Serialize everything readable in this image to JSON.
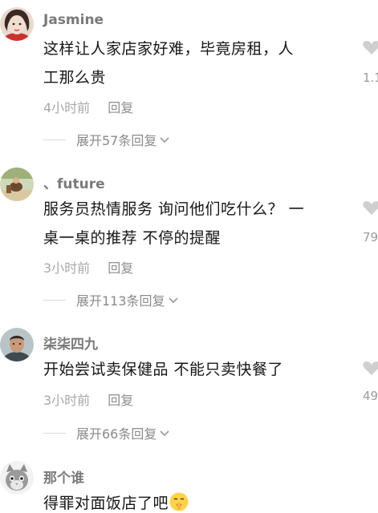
{
  "comments": [
    {
      "username": "Jasmine",
      "body_lines": [
        "这样让人家店家好难，毕竟房租，人",
        "工那么贵"
      ],
      "time": "4小时前",
      "reply_label": "回复",
      "expand_label": "展开57条回复",
      "like_count": "1.1"
    },
    {
      "username": "、future",
      "body_lines": [
        "服务员热情服务 询问他们吃什么？ 一",
        "桌一桌的推荐 不停的提醒"
      ],
      "time": "3小时前",
      "reply_label": "回复",
      "expand_label": "展开113条回复",
      "like_count": "79"
    },
    {
      "username": "柒柒四九",
      "body_lines": [
        "开始尝试卖保健品 不能只卖快餐了"
      ],
      "time": "3小时前",
      "reply_label": "回复",
      "expand_label": "展开66条回复",
      "like_count": "49"
    },
    {
      "username": "那个谁",
      "body_lines": [
        "得罪对面饭店了吧"
      ],
      "time": "",
      "reply_label": "",
      "expand_label": "",
      "like_count": ""
    }
  ],
  "icons": {
    "like": "heart-outline-icon",
    "expand": "chevron-down-icon",
    "emoji": "shushing-face-emoji-icon"
  },
  "colors": {
    "username": "#7a7a7a",
    "body": "#161616",
    "meta": "#a8a8a8",
    "icon": "#c8c8c8"
  }
}
